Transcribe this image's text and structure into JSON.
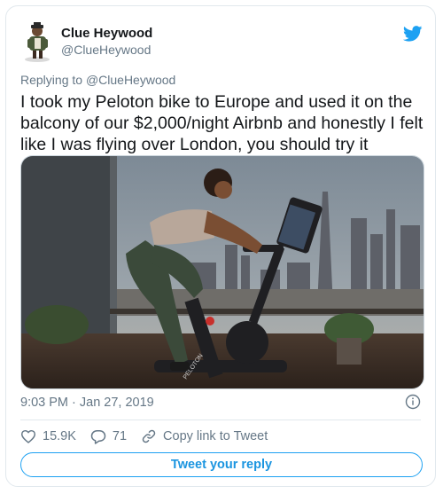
{
  "author": {
    "name": "Clue Heywood",
    "handle": "@ClueHeywood"
  },
  "reply_context": {
    "prefix": "Replying to",
    "target": "@ClueHeywood"
  },
  "tweet": {
    "text": "I took my Peloton bike to Europe and used it on the balcony of our $2,000/night Airbnb and honestly I felt like I was flying over London, you should try it",
    "media_bike_brand": "PELOTON"
  },
  "meta": {
    "timestamp": "9:03 PM · Jan 27, 2019"
  },
  "actions": {
    "likes": "15.9K",
    "replies": "71",
    "copy_link": "Copy link to Tweet"
  },
  "reply_button": {
    "label": "Tweet your reply"
  },
  "colors": {
    "twitter_blue": "#1da1f2",
    "secondary_text": "#657786",
    "border": "#e1e8ed"
  },
  "icons": [
    "avatar",
    "twitter-bird-icon",
    "info-icon",
    "heart-icon",
    "reply-bubble-icon",
    "link-icon"
  ]
}
